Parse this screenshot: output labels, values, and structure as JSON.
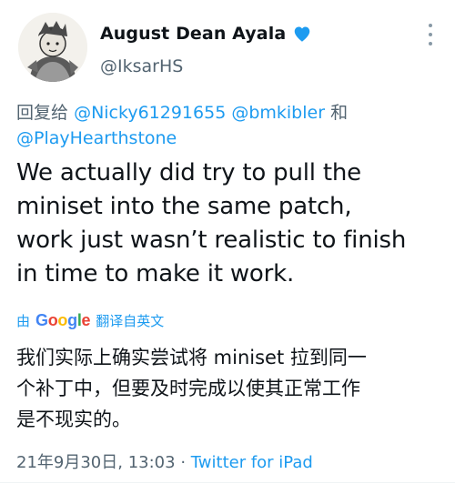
{
  "author": {
    "display_name": "August Dean Ayala",
    "handle": "@IksarHS",
    "verified": true,
    "avatar_icon": "illustrated-avatar"
  },
  "reply": {
    "prefix": "回复给",
    "mentions": [
      "@Nicky61291655",
      "@bmkibler",
      "@PlayHearthstone"
    ],
    "conjunction": "和"
  },
  "tweet": {
    "lines": [
      "We actually did try to pull the",
      "miniset into the same patch,",
      "work just wasn’t realistic to finish",
      "in time to make it work."
    ]
  },
  "translation_bar": {
    "prefix": "由",
    "provider": "Google",
    "suffix": "翻译自英文"
  },
  "translation": {
    "lines": [
      "我们实际上确实尝试将 miniset 拉到同一",
      "个补丁中，但要及时完成以使其正常工作",
      "是不现实的。"
    ]
  },
  "meta": {
    "timestamp": "21年9月30日, 13:03",
    "separator": "·",
    "source": "Twitter for iPad"
  },
  "colors": {
    "link": "#1d9bf0",
    "secondary_text": "#536471",
    "primary_text": "#0f1419",
    "verified": "#1d9bf0"
  }
}
